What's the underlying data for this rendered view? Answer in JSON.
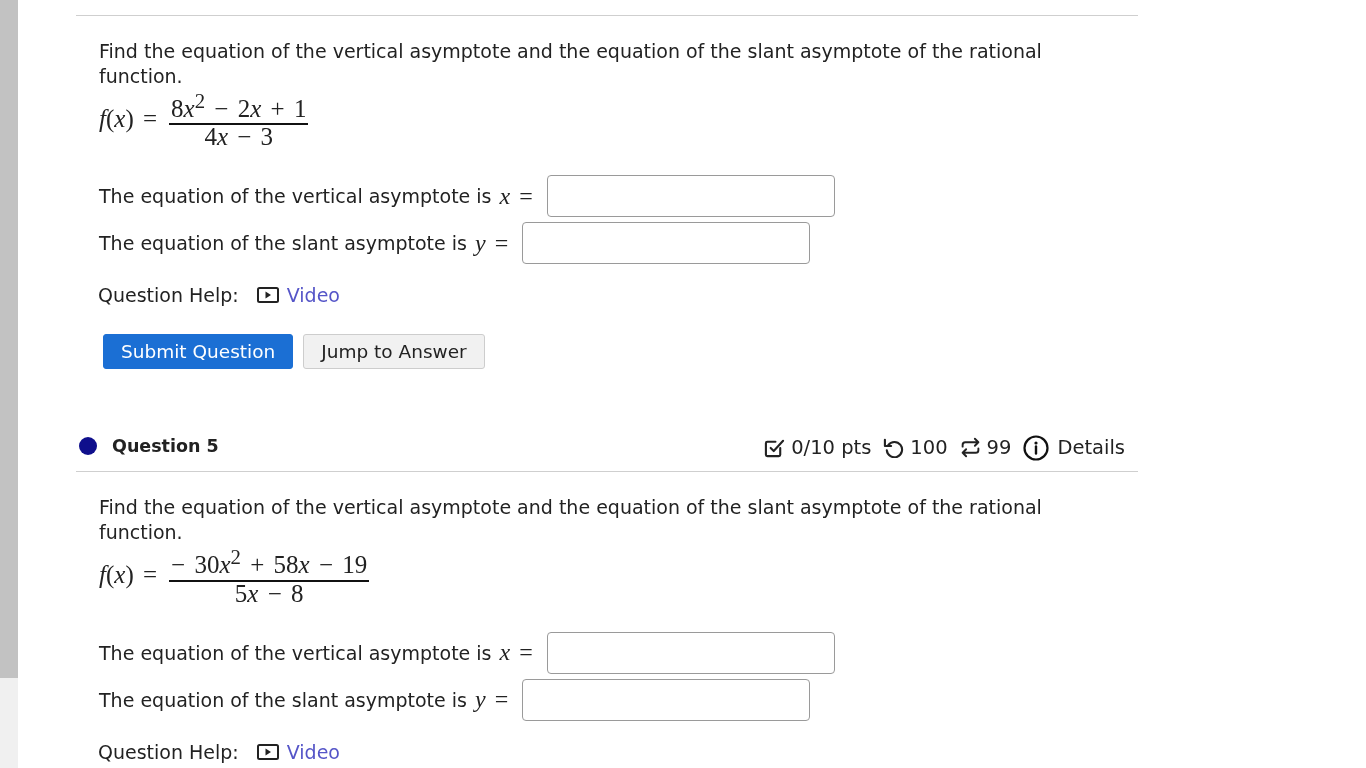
{
  "questions": [
    {
      "prompt": "Find the equation of the vertical asymptote and the equation of the slant asymptote of the rational function.",
      "function": {
        "lhs": "f(x) =",
        "numerator": "8x$^{2}$ − 2x + 1",
        "denominator": "4x − 3"
      },
      "answers": [
        {
          "label": "The equation of the vertical asymptote is",
          "variable": "x ="
        },
        {
          "label": "The equation of the slant asymptote is",
          "variable": "y ="
        }
      ],
      "help": {
        "label": "Question Help:",
        "link": "Video"
      },
      "buttons": [
        {
          "label": "Submit Question",
          "kind": "primary"
        },
        {
          "label": "Jump to Answer",
          "kind": "secondary"
        }
      ]
    },
    {
      "header": {
        "title": "Question 5",
        "score": "0/10 pts",
        "attempts": "100",
        "retries": "99",
        "details": "Details"
      },
      "prompt": "Find the equation of the vertical asymptote and the equation of the slant asymptote of the rational function.",
      "function": {
        "lhs": "f(x) =",
        "numerator": "− 30x$^{2}$ + 58x − 19",
        "denominator": "5x − 8"
      },
      "answers": [
        {
          "label": "The equation of the vertical asymptote is",
          "variable": "x ="
        },
        {
          "label": "The equation of the slant asymptote is",
          "variable": "y ="
        }
      ],
      "help": {
        "label": "Question Help:",
        "link": "Video"
      }
    }
  ]
}
